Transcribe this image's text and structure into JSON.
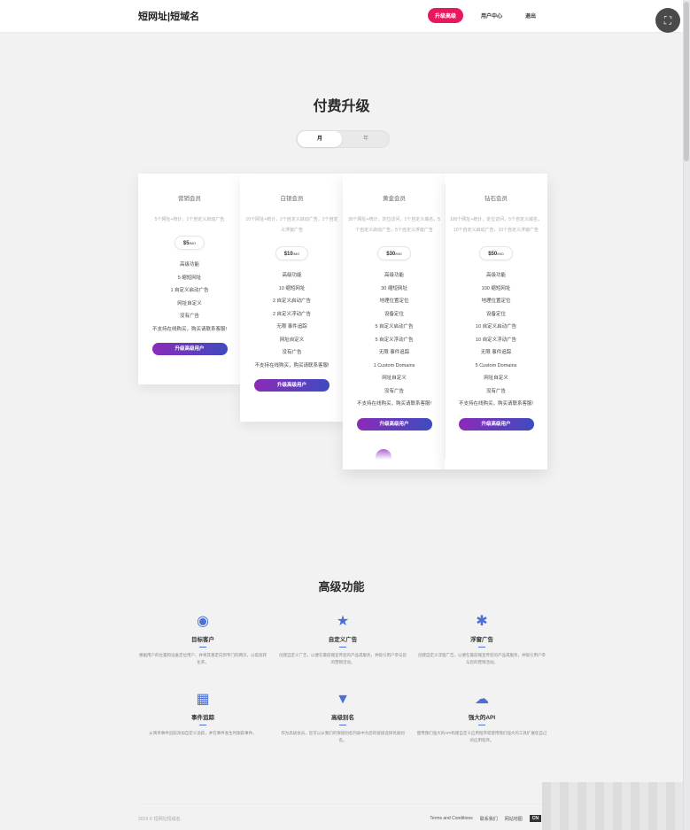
{
  "header": {
    "logo": "短网址|短域名",
    "nav": [
      "升级高级",
      "用户中心",
      "退出"
    ]
  },
  "pricing": {
    "title": "付费升级",
    "toggle": [
      "月",
      "年"
    ],
    "plans": [
      {
        "name": "营销会员",
        "desc": "5个网址+统计，1个自定义启动广告",
        "price": "$5",
        "unit": "/MO",
        "features": [
          "高级功能",
          "5 缩短网址",
          "1 自定义启动广告",
          "网址自定义",
          "没有广告",
          "不支持在线购买，购买请联系客服!"
        ],
        "button": "升级高级用户"
      },
      {
        "name": "白银会员",
        "desc": "10个网址+统计，2个自定义启动广告，2个自定义浮窗广告",
        "price": "$10",
        "unit": "/MO",
        "features": [
          "高级功能",
          "10 缩短网址",
          "2 自定义启动广告",
          "2 自定义浮动广告",
          "无限 事件追踪",
          "网址自定义",
          "没有广告",
          "不支持在线购买，购买请联系客服!"
        ],
        "button": "升级高级用户"
      },
      {
        "name": "黄金会员",
        "desc": "30个网址+统计，定位访问，1个自定义域名，5个自定义启动广告，5个自定义浮窗广告",
        "price": "$30",
        "unit": "/MO",
        "features": [
          "高级功能",
          "30 缩短网址",
          "地理位置定位",
          "设备定位",
          "5 自定义启动广告",
          "5 自定义浮动广告",
          "无限 事件追踪",
          "1 Custom Domains",
          "网址自定义",
          "没有广告",
          "不支持在线购买，购买请联系客服!"
        ],
        "button": "升级高级用户"
      },
      {
        "name": "钻石会员",
        "desc": "100个网址+统计，定位访问，5个自定义域名，10个自定义启动广告，10个自定义浮窗广告",
        "price": "$50",
        "unit": "/MO",
        "features": [
          "高级功能",
          "100 缩短网址",
          "地理位置定位",
          "设备定位",
          "10 自定义启动广告",
          "10 自定义浮动广告",
          "无限 事件追踪",
          "5 Custom Domains",
          "网址自定义",
          "没有广告",
          "不支持在线购买，购买请联系客服!"
        ],
        "button": "升级高级用户"
      }
    ]
  },
  "features": {
    "title": "高级功能",
    "items": [
      {
        "icon": "globe-icon",
        "glyph": "🌐",
        "title": "目标客户",
        "desc": "根据用户的位置和设备定位用户，并将其重定向到专门的网页，以提高转化率。"
      },
      {
        "icon": "star-icon",
        "glyph": "★",
        "title": "自定义广告",
        "desc": "创建自定义广告，以便在最前端宣传您的产品或服务，并吸引用户参与您的营销活动。"
      },
      {
        "icon": "asterisk-icon",
        "glyph": "✱",
        "title": "浮窗广告",
        "desc": "创建自定义浮窗广告，以便在最前端宣传您的产品或服务，并吸引用户参与您的营销活动。"
      },
      {
        "icon": "grid-icon",
        "glyph": "▦",
        "title": "事件追踪",
        "desc": "从简单事件追踪添加自定义追踪，并在事件发生时跟踪事件。"
      },
      {
        "icon": "cocktail-icon",
        "glyph": "🍸",
        "title": "高级别名",
        "desc": "作为高级会员，您可以从我们的保留别名列表中为您的链接选择优质别名。"
      },
      {
        "icon": "cloud-icon",
        "glyph": "☁",
        "title": "强大的API",
        "desc": "使用我们强大的API构建自定义应用程序或使用我们强大的工具扩展您自己的应用程序。"
      }
    ]
  },
  "footer": {
    "copyright": "2019 © 短网址短域名.",
    "links": [
      "Terms and Conditions",
      "联系我们",
      "网站地图"
    ],
    "lang": "CN"
  }
}
